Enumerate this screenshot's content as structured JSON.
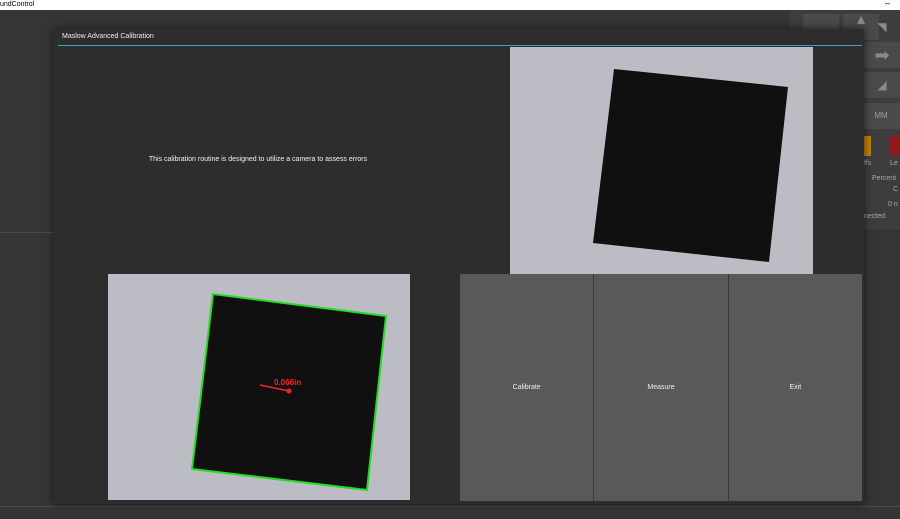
{
  "os": {
    "window_title": "undControl",
    "minimize_glyph": "–"
  },
  "background": {
    "mm_button": "MM",
    "status_texts": [
      "ffs",
      "Le",
      "Percent",
      "C",
      "0 n",
      "nected"
    ]
  },
  "dialog": {
    "title": "Maslow Advanced Calibration",
    "description": "This calibration routine is designed to utilize a camera to assess errors",
    "measurement": "0.066in",
    "buttons": {
      "calibrate": "Calibrate",
      "measure": "Measure",
      "exit": "Exit"
    }
  },
  "colors": {
    "accent": "#3a9fd4",
    "outline": "#22dd22",
    "measurement": "#ff2020",
    "button_bg": "#595959",
    "modal_bg": "#2d2d2d"
  }
}
